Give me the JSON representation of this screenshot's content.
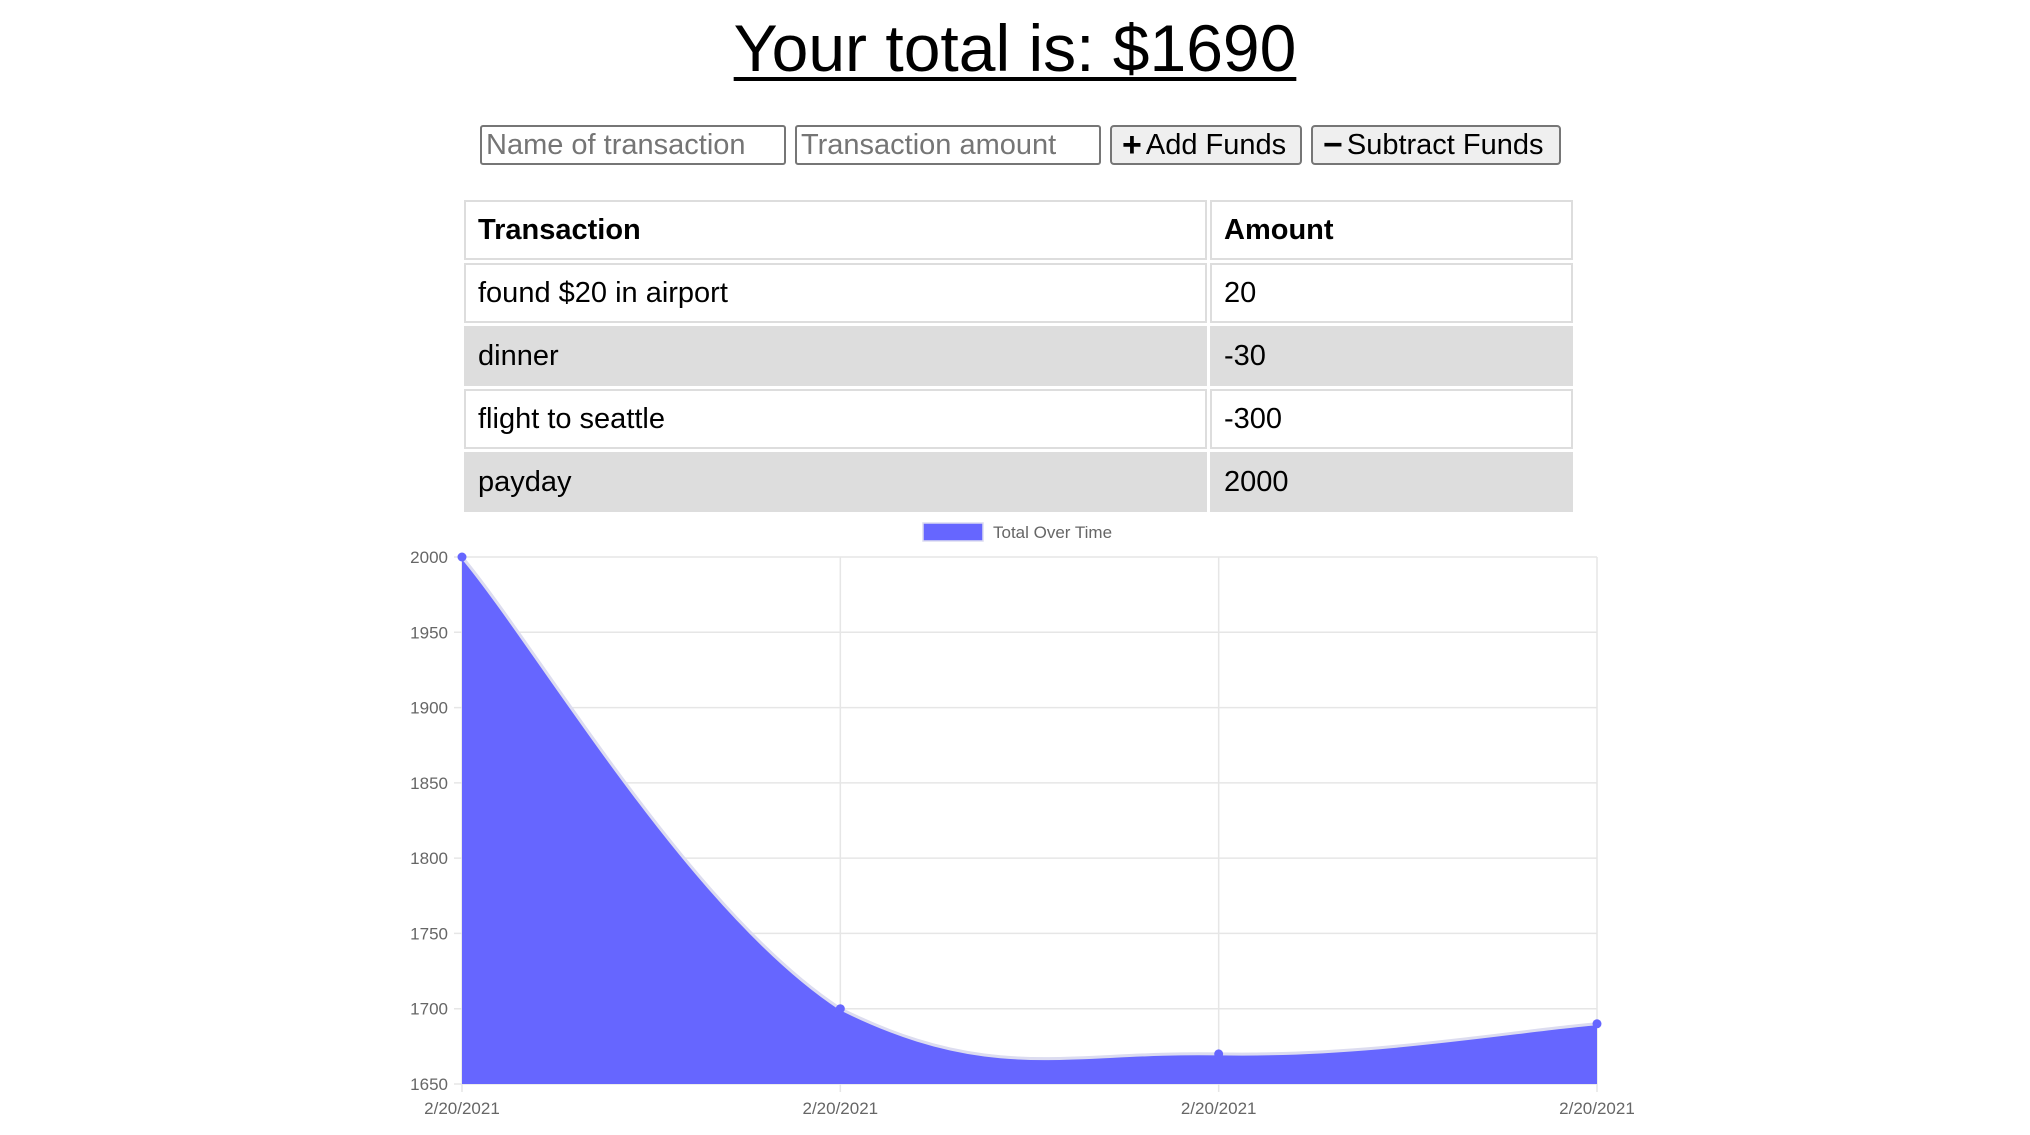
{
  "header": {
    "title": "Your total is: $1690"
  },
  "form": {
    "name_placeholder": "Name of transaction",
    "amount_placeholder": "Transaction amount",
    "add_label": "Add Funds",
    "subtract_label": "Subtract Funds"
  },
  "table": {
    "headers": [
      "Transaction",
      "Amount"
    ],
    "rows": [
      {
        "name": "found $20 in airport",
        "amount": "20"
      },
      {
        "name": "dinner",
        "amount": "-30"
      },
      {
        "name": "flight to seattle",
        "amount": "-300"
      },
      {
        "name": "payday",
        "amount": "2000"
      }
    ]
  },
  "chart_data": {
    "type": "area",
    "legend": {
      "label": "Total Over Time",
      "position": "top"
    },
    "x": [
      "2/20/2021",
      "2/20/2021",
      "2/20/2021",
      "2/20/2021"
    ],
    "series": [
      {
        "name": "Total Over Time",
        "values": [
          2000,
          1700,
          1670,
          1690
        ]
      }
    ],
    "ylim": [
      1650,
      2000
    ],
    "yticks": [
      2000,
      1950,
      1900,
      1850,
      1800,
      1750,
      1700,
      1650
    ],
    "grid": true,
    "colors": {
      "fill": "#6666ff",
      "line": "#dcdcf0",
      "point": "#6666ff"
    }
  }
}
